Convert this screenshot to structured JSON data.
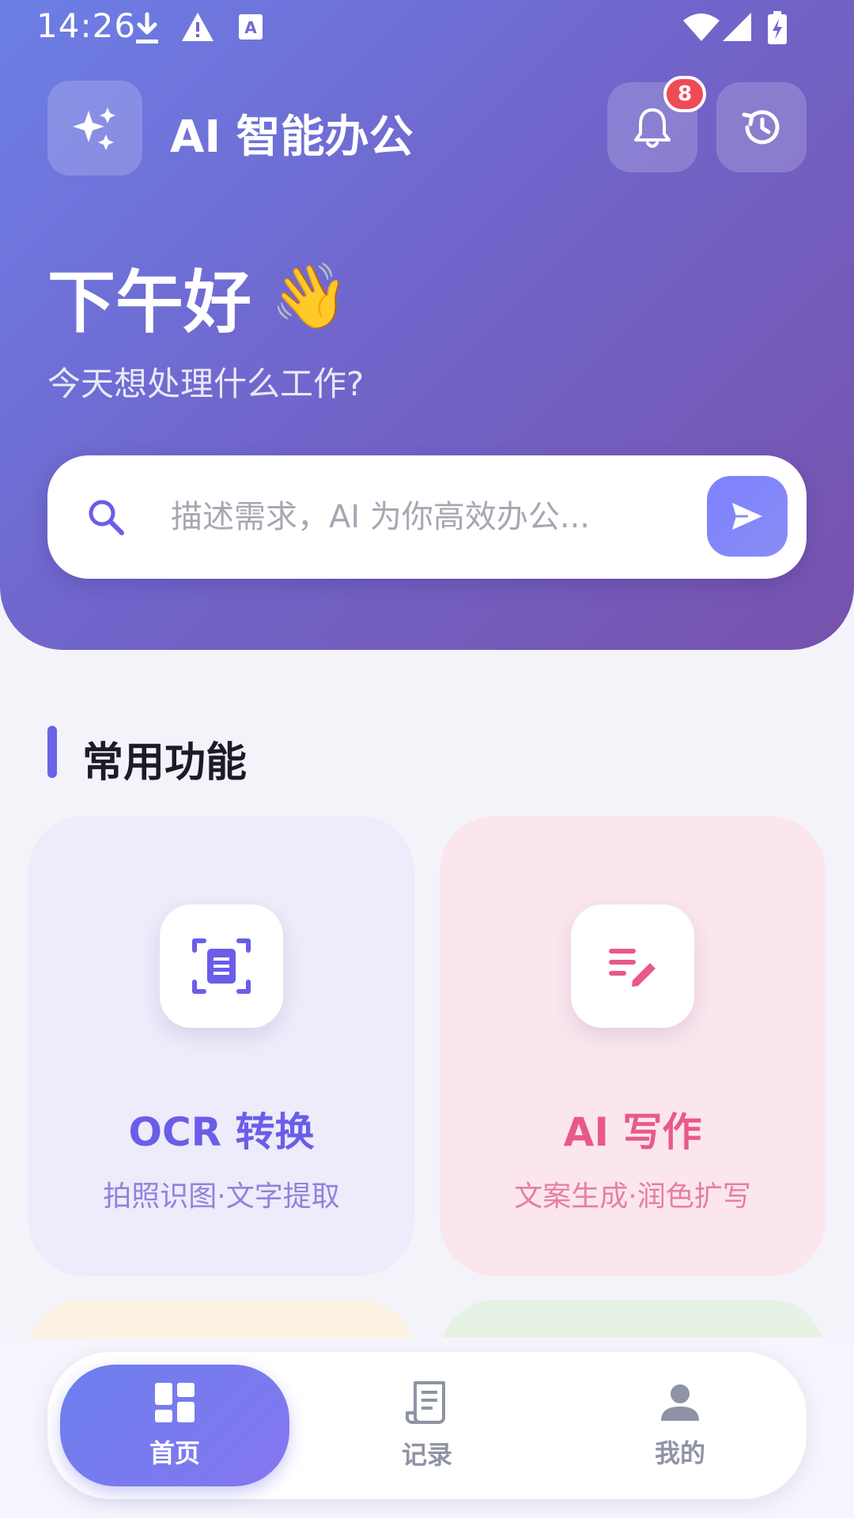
{
  "status_bar": {
    "time": "14:26",
    "icons": [
      "download-icon",
      "warning-icon",
      "keyboard-a-icon",
      "wifi-icon",
      "signal-icon",
      "battery-charging-icon"
    ]
  },
  "header": {
    "app_title": "AI 智能办公",
    "notification_count": "8"
  },
  "hero": {
    "greeting": "下午好",
    "greeting_emoji": "👋",
    "subtitle": "今天想处理什么工作?"
  },
  "search": {
    "placeholder": "描述需求，AI 为你高效办公...",
    "value": ""
  },
  "section": {
    "title": "常用功能"
  },
  "features": [
    {
      "title": "OCR 转换",
      "desc": "拍照识图·文字提取",
      "icon": "document-scan-icon",
      "color": "#6a5ee8"
    },
    {
      "title": "AI 写作",
      "desc": "文案生成·润色扩写",
      "icon": "edit-note-icon",
      "color": "#e8598a"
    }
  ],
  "nav": {
    "items": [
      {
        "label": "首页",
        "icon": "dashboard-icon",
        "active": true
      },
      {
        "label": "记录",
        "icon": "receipt-icon",
        "active": false
      },
      {
        "label": "我的",
        "icon": "person-icon",
        "active": false
      }
    ]
  },
  "colors": {
    "accent": "#6a63e6",
    "badge": "#ef4b57"
  }
}
